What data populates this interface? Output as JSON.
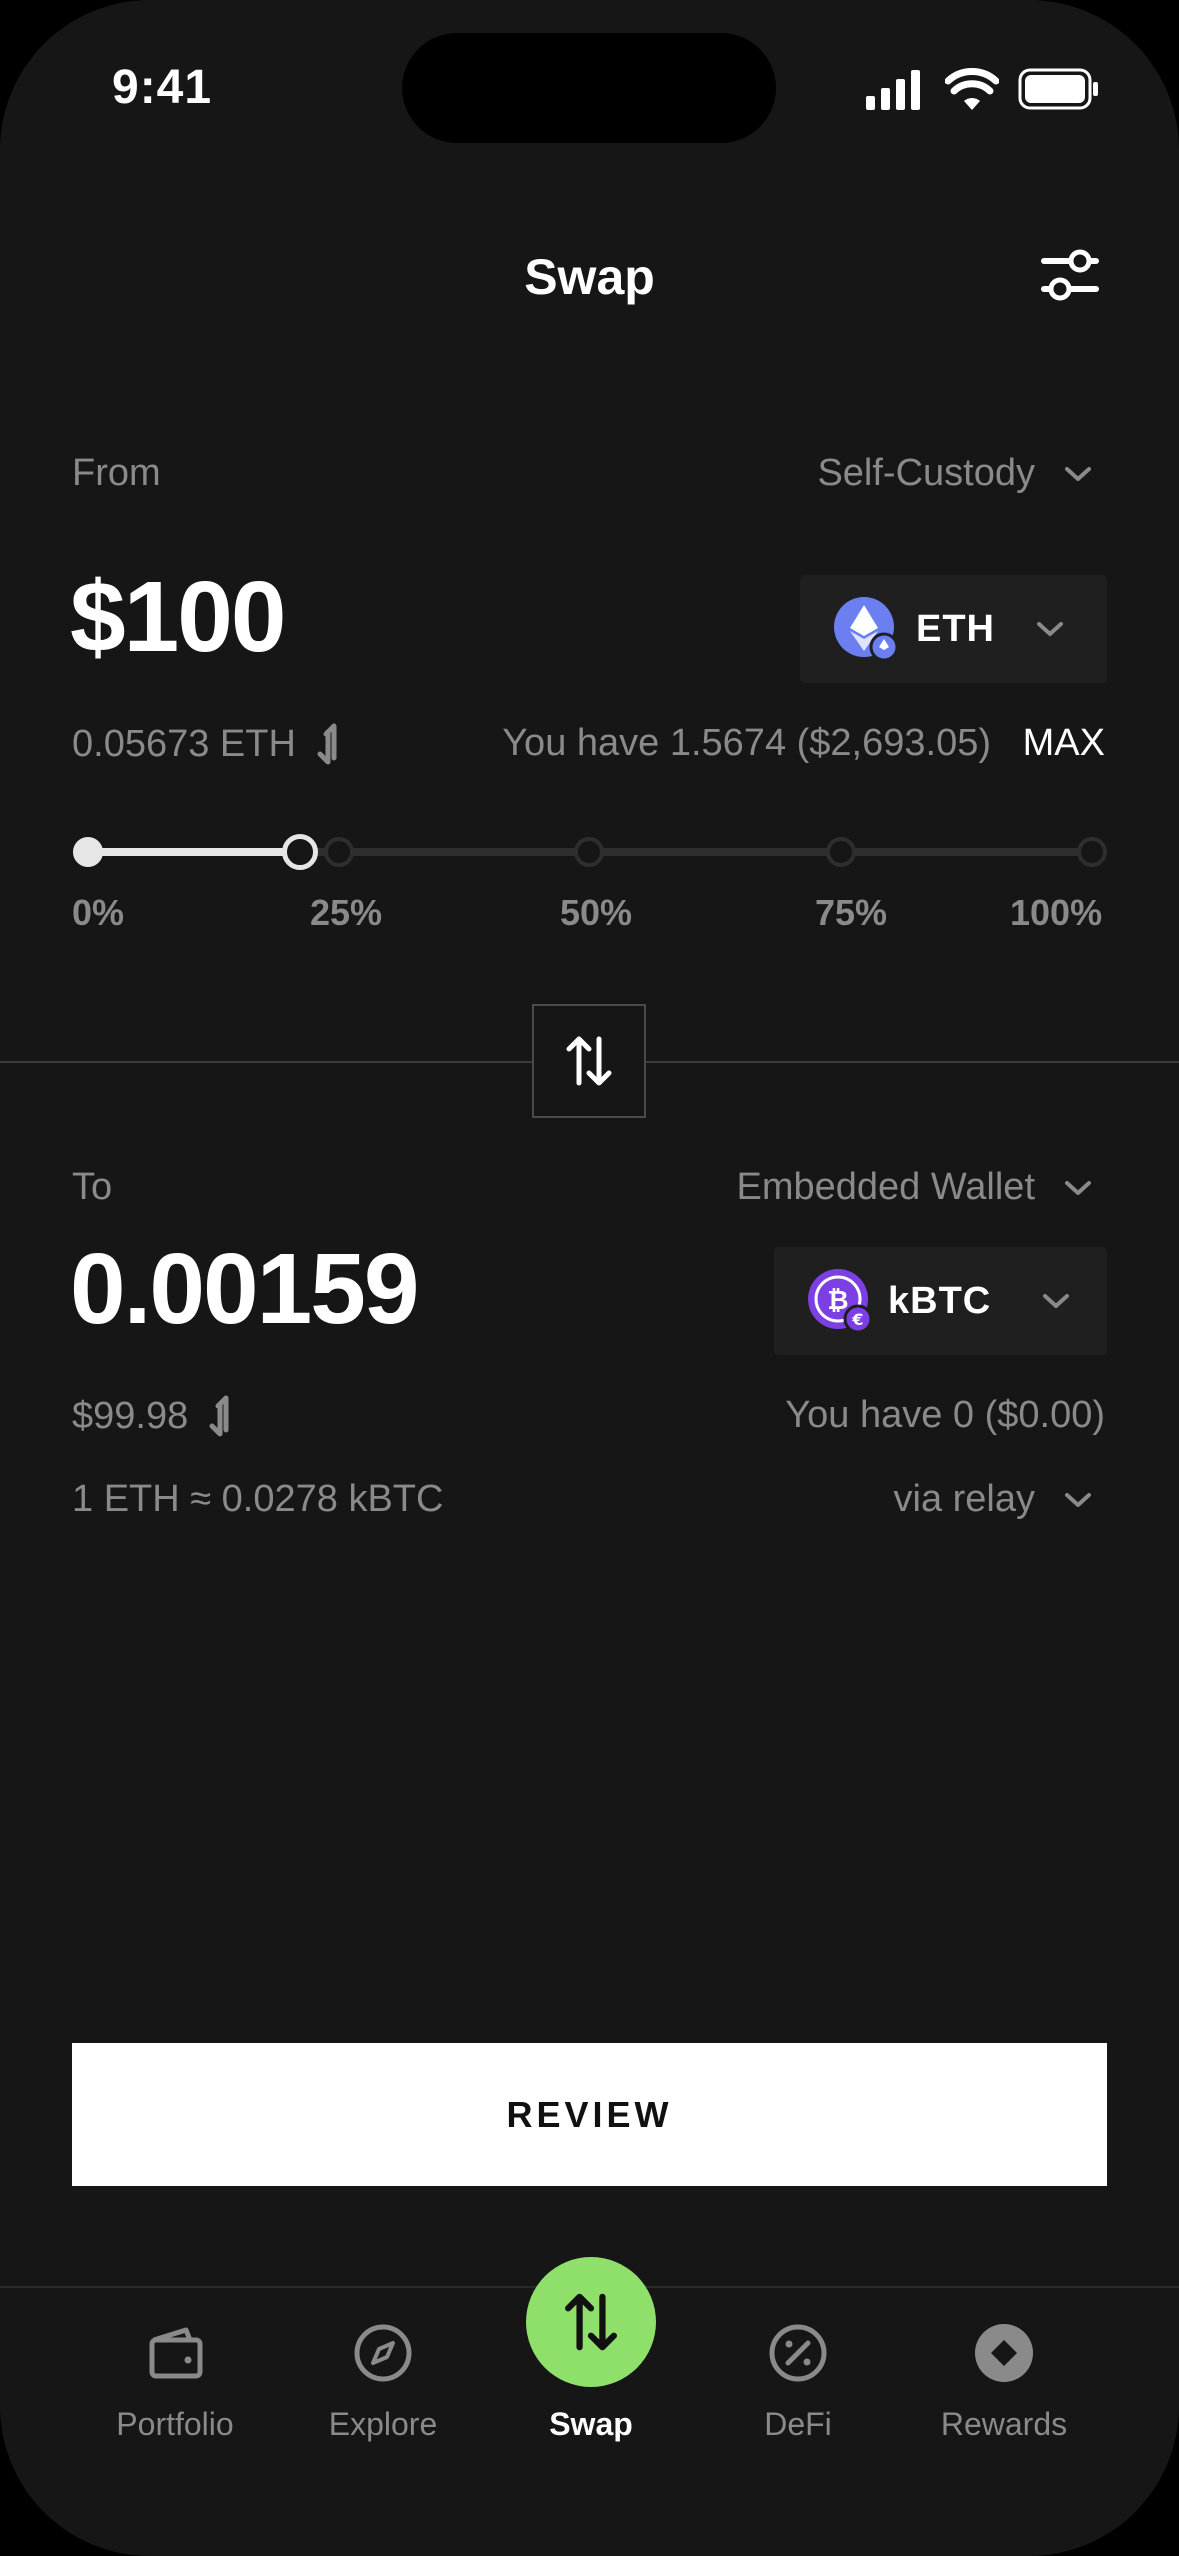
{
  "status_bar": {
    "time": "9:41"
  },
  "header": {
    "title": "Swap",
    "settings_icon": "sliders-icon"
  },
  "from": {
    "label": "From",
    "wallet": "Self-Custody",
    "amount": "$100",
    "token": "ETH",
    "converted": "0.05673 ETH",
    "balance": "You have 1.5674 ($2,693.05)",
    "max_label": "MAX",
    "slider": {
      "value_fraction": 0.21,
      "ticks": [
        "0%",
        "25%",
        "50%",
        "75%",
        "100%"
      ]
    }
  },
  "to": {
    "label": "To",
    "wallet": "Embedded Wallet",
    "amount": "0.00159",
    "token": "kBTC",
    "converted": "$99.98",
    "balance": "You have 0 ($0.00)",
    "rate": "1 ETH ≈ 0.0278 kBTC",
    "route": "via relay"
  },
  "review_label": "REVIEW",
  "nav": {
    "items": [
      {
        "label": "Portfolio",
        "icon": "wallet-icon"
      },
      {
        "label": "Explore",
        "icon": "compass-icon"
      },
      {
        "label": "Swap",
        "icon": "swap-icon"
      },
      {
        "label": "DeFi",
        "icon": "percent-icon"
      },
      {
        "label": "Rewards",
        "icon": "diamond-icon"
      }
    ]
  },
  "colors": {
    "background": "#161616",
    "accent_green": "#8ee06a",
    "eth": "#6b7ff0",
    "kbtc": "#7b3fe4"
  }
}
